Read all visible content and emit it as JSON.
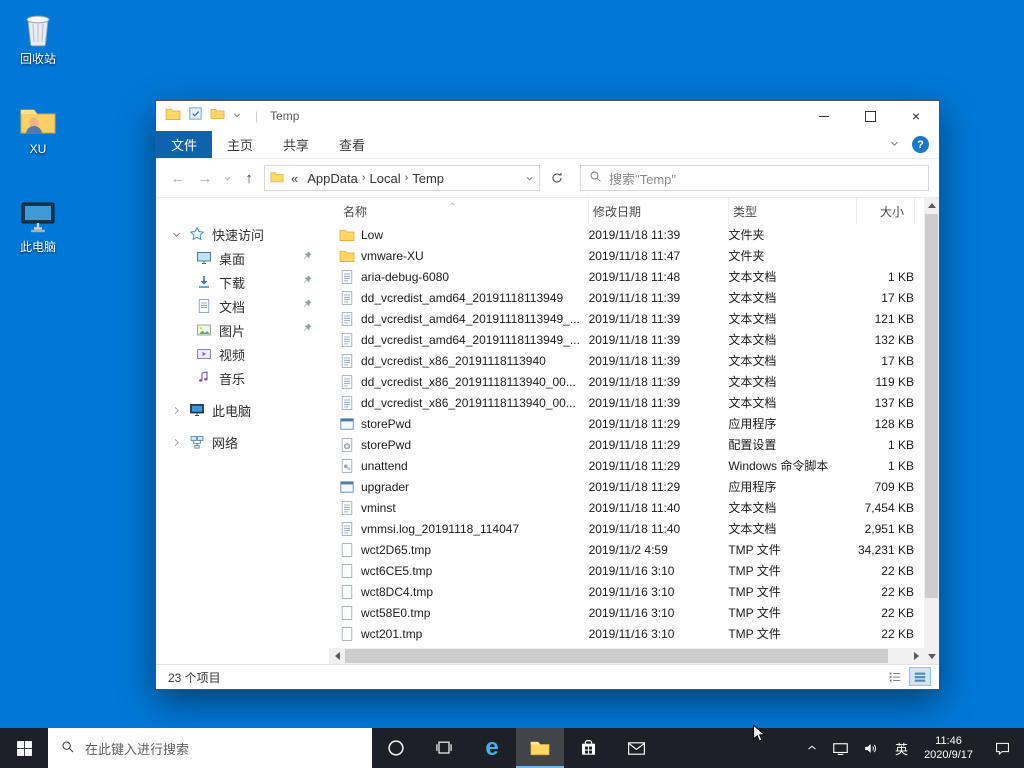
{
  "desktop": {
    "icons": [
      {
        "id": "recycle-bin",
        "label": "回收站"
      },
      {
        "id": "user-folder-xu",
        "label": "XU"
      },
      {
        "id": "this-pc",
        "label": "此电脑"
      }
    ]
  },
  "explorer": {
    "title": "Temp",
    "ribbon_tabs": [
      {
        "id": "file",
        "label": "文件",
        "active": true
      },
      {
        "id": "home",
        "label": "主页",
        "active": false
      },
      {
        "id": "share",
        "label": "共享",
        "active": false
      },
      {
        "id": "view",
        "label": "查看",
        "active": false
      }
    ],
    "nav": {
      "breadcrumb_prefix": "«",
      "breadcrumbs": [
        "AppData",
        "Local",
        "Temp"
      ],
      "search_placeholder": "搜索\"Temp\""
    },
    "sidebar": [
      {
        "id": "quick-access",
        "label": "快速访问",
        "icon": "star",
        "chevron": "down",
        "indent": 0,
        "pinned": false,
        "group": false
      },
      {
        "id": "desktop",
        "label": "桌面",
        "icon": "desktop",
        "indent": 1,
        "pinned": true,
        "group": false
      },
      {
        "id": "downloads",
        "label": "下载",
        "icon": "download",
        "indent": 1,
        "pinned": true,
        "group": false
      },
      {
        "id": "documents",
        "label": "文档",
        "icon": "document",
        "indent": 1,
        "pinned": true,
        "group": false
      },
      {
        "id": "pictures",
        "label": "图片",
        "icon": "picture",
        "indent": 1,
        "pinned": true,
        "group": false
      },
      {
        "id": "videos",
        "label": "视频",
        "icon": "video",
        "indent": 1,
        "pinned": false,
        "group": false
      },
      {
        "id": "music",
        "label": "音乐",
        "icon": "music",
        "indent": 1,
        "pinned": false,
        "group": false
      },
      {
        "id": "this-pc",
        "label": "此电脑",
        "icon": "computer",
        "chevron": "right",
        "indent": 0,
        "pinned": false,
        "group": true
      },
      {
        "id": "network",
        "label": "网络",
        "icon": "network",
        "chevron": "right",
        "indent": 0,
        "pinned": false,
        "group": true
      }
    ],
    "columns": [
      {
        "id": "name",
        "label": "名称"
      },
      {
        "id": "date-modified",
        "label": "修改日期"
      },
      {
        "id": "type",
        "label": "类型"
      },
      {
        "id": "size",
        "label": "大小"
      }
    ],
    "files": [
      {
        "name": "Low",
        "icon": "folder",
        "date": "2019/11/18 11:39",
        "type": "文件夹",
        "size": ""
      },
      {
        "name": "vmware-XU",
        "icon": "folder",
        "date": "2019/11/18 11:47",
        "type": "文件夹",
        "size": ""
      },
      {
        "name": "aria-debug-6080",
        "icon": "text",
        "date": "2019/11/18 11:48",
        "type": "文本文档",
        "size": "1 KB"
      },
      {
        "name": "dd_vcredist_amd64_20191118113949",
        "icon": "text",
        "date": "2019/11/18 11:39",
        "type": "文本文档",
        "size": "17 KB"
      },
      {
        "name": "dd_vcredist_amd64_20191118113949_...",
        "icon": "text",
        "date": "2019/11/18 11:39",
        "type": "文本文档",
        "size": "121 KB"
      },
      {
        "name": "dd_vcredist_amd64_20191118113949_...",
        "icon": "text",
        "date": "2019/11/18 11:39",
        "type": "文本文档",
        "size": "132 KB"
      },
      {
        "name": "dd_vcredist_x86_20191118113940",
        "icon": "text",
        "date": "2019/11/18 11:39",
        "type": "文本文档",
        "size": "17 KB"
      },
      {
        "name": "dd_vcredist_x86_20191118113940_00...",
        "icon": "text",
        "date": "2019/11/18 11:39",
        "type": "文本文档",
        "size": "119 KB"
      },
      {
        "name": "dd_vcredist_x86_20191118113940_00...",
        "icon": "text",
        "date": "2019/11/18 11:39",
        "type": "文本文档",
        "size": "137 KB"
      },
      {
        "name": "storePwd",
        "icon": "app",
        "date": "2019/11/18 11:29",
        "type": "应用程序",
        "size": "128 KB"
      },
      {
        "name": "storePwd",
        "icon": "config",
        "date": "2019/11/18 11:29",
        "type": "配置设置",
        "size": "1 KB"
      },
      {
        "name": "unattend",
        "icon": "script",
        "date": "2019/11/18 11:29",
        "type": "Windows 命令脚本",
        "size": "1 KB"
      },
      {
        "name": "upgrader",
        "icon": "app",
        "date": "2019/11/18 11:29",
        "type": "应用程序",
        "size": "709 KB"
      },
      {
        "name": "vminst",
        "icon": "text",
        "date": "2019/11/18 11:40",
        "type": "文本文档",
        "size": "7,454 KB"
      },
      {
        "name": "vmmsi.log_20191118_114047",
        "icon": "text",
        "date": "2019/11/18 11:40",
        "type": "文本文档",
        "size": "2,951 KB"
      },
      {
        "name": "wct2D65.tmp",
        "icon": "tmp",
        "date": "2019/11/2 4:59",
        "type": "TMP 文件",
        "size": "34,231 KB"
      },
      {
        "name": "wct6CE5.tmp",
        "icon": "tmp",
        "date": "2019/11/16 3:10",
        "type": "TMP 文件",
        "size": "22 KB"
      },
      {
        "name": "wct8DC4.tmp",
        "icon": "tmp",
        "date": "2019/11/16 3:10",
        "type": "TMP 文件",
        "size": "22 KB"
      },
      {
        "name": "wct58E0.tmp",
        "icon": "tmp",
        "date": "2019/11/16 3:10",
        "type": "TMP 文件",
        "size": "22 KB"
      },
      {
        "name": "wct201.tmp",
        "icon": "tmp",
        "date": "2019/11/16 3:10",
        "type": "TMP 文件",
        "size": "22 KB"
      }
    ],
    "status_text": "23 个项目"
  },
  "taskbar": {
    "search_placeholder": "在此键入进行搜索",
    "tray": {
      "lang": "英",
      "time": "11:46",
      "date": "2020/9/17"
    }
  }
}
